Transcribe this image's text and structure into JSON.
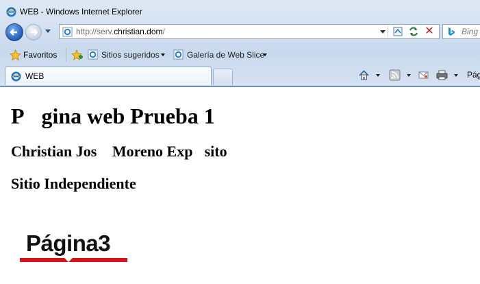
{
  "window": {
    "title": "WEB - Windows Internet Explorer"
  },
  "address_bar": {
    "url_prefix": "http://serv.",
    "url_host": "christian.dom",
    "url_suffix": "/"
  },
  "search": {
    "placeholder": "Bing"
  },
  "favorites_bar": {
    "favorites_label": "Favoritos",
    "links": [
      {
        "label": "Sitios sugeridos"
      },
      {
        "label": "Galería de Web Slice"
      }
    ]
  },
  "tabs": [
    {
      "label": "WEB"
    }
  ],
  "command_bar": {
    "page_label": "Pág"
  },
  "page": {
    "heading": "P\u0000gina web Prueba 1",
    "author": "Christian Jos\u0000 Moreno Exp\u0000sito",
    "site_type": "Sitio Independiente",
    "logo_text": "Página3"
  },
  "colors": {
    "accent": "#1f5bb5",
    "logo_bar": "#d3141b"
  }
}
